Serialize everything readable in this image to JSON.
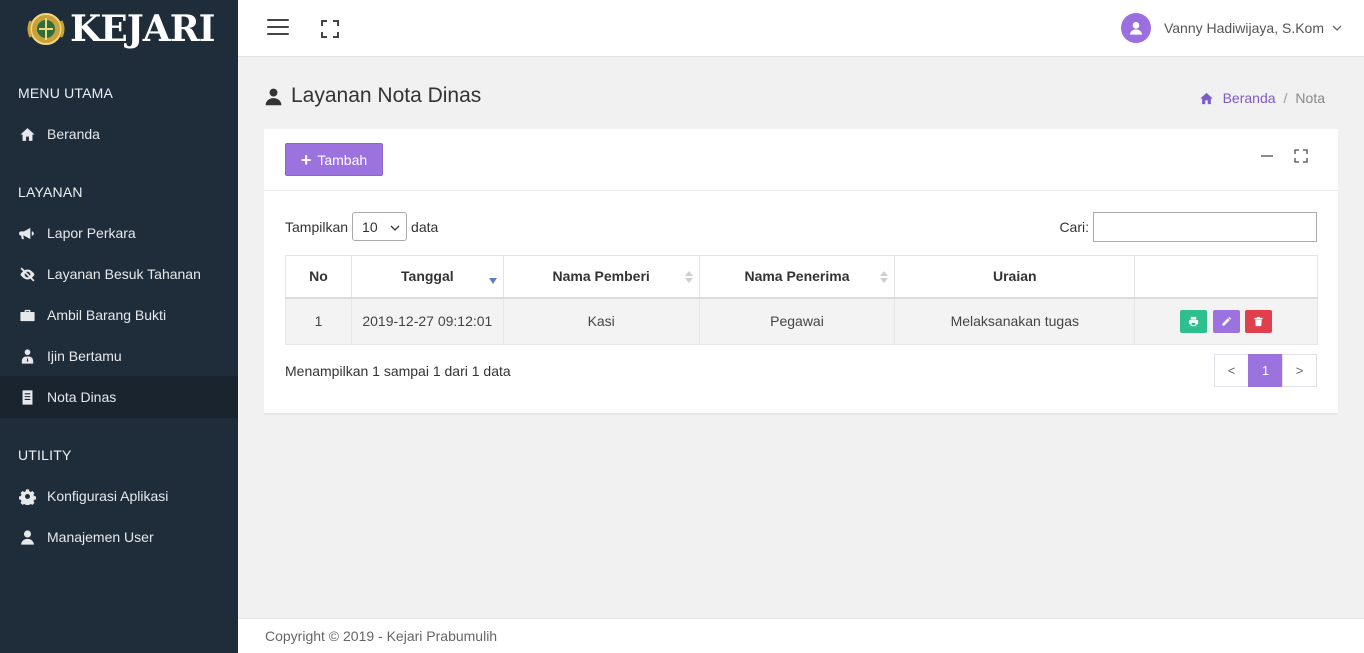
{
  "brand": {
    "name": "KEJARI",
    "logo_icon": "kejaksaan-emblem"
  },
  "sidebar": {
    "sections": [
      {
        "title": "MENU UTAMA",
        "items": [
          {
            "label": "Beranda",
            "icon": "home-icon"
          }
        ]
      },
      {
        "title": "LAYANAN",
        "items": [
          {
            "label": "Lapor Perkara",
            "icon": "megaphone-icon"
          },
          {
            "label": "Layanan Besuk Tahanan",
            "icon": "eye-slash-icon"
          },
          {
            "label": "Ambil Barang Bukti",
            "icon": "briefcase-icon"
          },
          {
            "label": "Ijin Bertamu",
            "icon": "user-tie-icon"
          },
          {
            "label": "Nota Dinas",
            "icon": "document-icon",
            "active": true
          }
        ]
      },
      {
        "title": "UTILITY",
        "items": [
          {
            "label": "Konfigurasi Aplikasi",
            "icon": "gear-icon"
          },
          {
            "label": "Manajemen User",
            "icon": "user-icon"
          }
        ]
      }
    ]
  },
  "topbar": {
    "user_name": "Vanny Hadiwijaya, S.Kom"
  },
  "page": {
    "title": "Layanan Nota Dinas",
    "breadcrumb": {
      "home": "Beranda",
      "separator": "/",
      "current": "Nota"
    }
  },
  "card": {
    "add_button": "Tambah",
    "length": {
      "prefix": "Tampilkan",
      "value": "10",
      "suffix": "data"
    },
    "search": {
      "label": "Cari:",
      "value": ""
    },
    "table": {
      "columns": [
        "No",
        "Tanggal",
        "Nama Pemberi",
        "Nama Penerima",
        "Uraian",
        ""
      ],
      "rows": [
        {
          "no": "1",
          "tanggal": "2019-12-27 09:12:01",
          "pemberi": "Kasi",
          "penerima": "Pegawai",
          "uraian": "Melaksanakan tugas"
        }
      ]
    },
    "info": "Menampilkan 1 sampai 1 dari 1 data",
    "pagination": {
      "prev": "<",
      "page": "1",
      "next": ">"
    }
  },
  "footer": {
    "text": "Copyright © 2019 - Kejari Prabumulih"
  },
  "colors": {
    "sidebar_bg": "#1f2d3a",
    "accent": "#9b72de",
    "print": "#2fbf8f",
    "edit": "#9b72de",
    "delete": "#e0404b"
  }
}
